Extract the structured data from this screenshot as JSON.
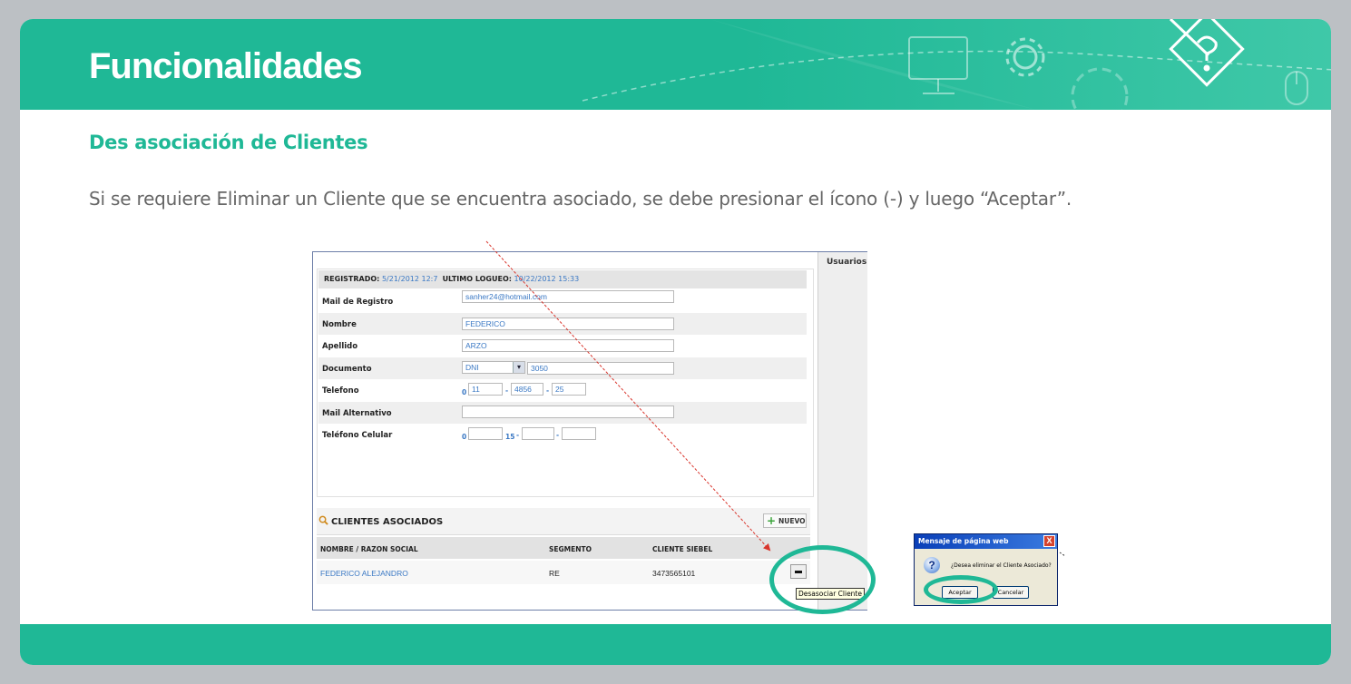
{
  "slide": {
    "title": "Funcionalidades",
    "subtitle": "Des asociación de Clientes",
    "paragraph": "Si se requiere Eliminar un Cliente que se encuentra asociado, se debe presionar el ícono (-) y luego “Aceptar”."
  },
  "screenshot": {
    "side_tab": "Usuarios",
    "registered_label": "REGISTRADO:",
    "registered_value": "5/21/2012 12:7",
    "last_login_label": "ULTIMO LOGUEO:",
    "last_login_value": "10/22/2012 15:33",
    "fields": [
      {
        "label": "Mail de Registro",
        "value": "sanher24@hotmail.com"
      },
      {
        "label": "Nombre",
        "value": "FEDERICO"
      },
      {
        "label": "Apellido",
        "value": "ARZO"
      },
      {
        "label": "Documento",
        "doc_type": "DNI",
        "value": "3050"
      },
      {
        "label": "Telefono",
        "prefix": "0",
        "area": "11",
        "part1": "4856",
        "part2": "25"
      },
      {
        "label": "Mail Alternativo",
        "value": ""
      },
      {
        "label": "Teléfono Celular",
        "prefix": "0",
        "mid": "15",
        "area": "",
        "part1": "",
        "part2": ""
      }
    ],
    "clients_title": "CLIENTES ASOCIADOS",
    "new_button": "NUEVO",
    "columns": [
      "NOMBRE / RAZON SOCIAL",
      "SEGMENTO",
      "CLIENTE SIEBEL"
    ],
    "rows": [
      {
        "name": "FEDERICO ALEJANDRO",
        "segment": "RE",
        "siebel": "3473565101"
      }
    ],
    "tooltip": "Desasociar Cliente"
  },
  "dialog": {
    "title": "Mensaje de página web",
    "message": "¿Desea eliminar el Cliente Asociado?",
    "accept": "Aceptar",
    "cancel": "Cancelar",
    "close": "X",
    "question_glyph": "?"
  },
  "colors": {
    "accent": "#1fb896",
    "link": "#3a78c4",
    "arrow": "#d9342b"
  },
  "icons": [
    "settings-gear-icon",
    "computer-monitor-icon",
    "mouse-icon",
    "pencil-question-icon",
    "search-lens-icon",
    "plus-icon",
    "minus-icon",
    "question-icon",
    "close-icon"
  ]
}
